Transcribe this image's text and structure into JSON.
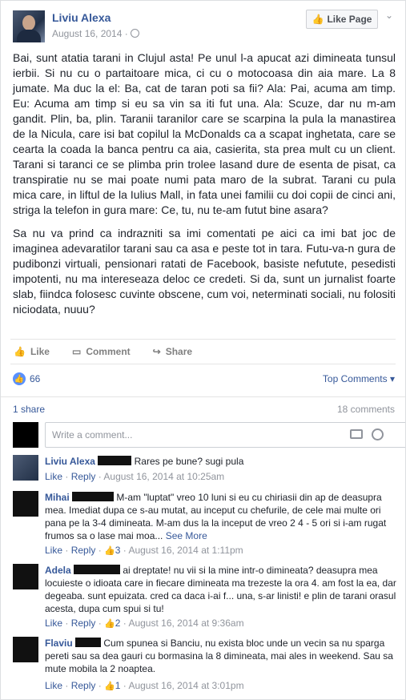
{
  "post": {
    "author": "Liviu Alexa",
    "date": "August 16, 2014 ·",
    "like_page": "Like Page",
    "paragraphs": [
      "Bai, sunt atatia tarani in Clujul asta! Pe unul l-a apucat azi dimineata tunsul ierbii. Si nu cu o partaitoare mica, ci cu o motocoasa din aia mare. La 8 jumate. Ma duc la el: Ba, cat de taran poti sa fii? Ala: Pai, acuma am timp. Eu: Acuma am timp si eu sa vin sa iti fut una. Ala: Scuze, dar nu m-am gandit. Plin, ba, plin. Taranii taranilor care se scarpina la pula la manastirea de la Nicula, care isi bat copilul la McDonalds ca a scapat inghetata, care se cearta la coada la banca pentru ca aia, casierita, sta prea mult cu un client. Tarani si taranci ce se plimba prin trolee lasand dure de esenta de pisat, ca transpiratie nu se mai poate numi pata maro de la subrat. Tarani cu pula mica care, in liftul de la Iulius Mall, in fata unei familii cu doi copii de cinci ani, striga la telefon in gura mare: Ce, tu, nu te-am futut bine asara?",
      "Sa nu va prind ca indrazniti sa imi comentati pe aici ca imi bat joc de imaginea adevaratilor tarani sau ca asa e peste tot in tara. Futu-va-n gura de pudibonzi virtuali, pensionari ratati de Facebook, basiste nefutute, pesedisti impotenti, nu ma intereseaza deloc ce credeti. Si da, sunt un jurnalist foarte slab, fiindca folosesc cuvinte obscene, cum voi, neterminati sociali, nu folositi niciodata, nuuu?"
    ],
    "actions": {
      "like": "Like",
      "comment": "Comment",
      "share": "Share"
    },
    "likes": "66",
    "sort": "Top Comments",
    "shares": "1 share",
    "comments_count": "18 comments",
    "write_placeholder": "Write a comment..."
  },
  "comments": [
    {
      "name": "Liviu Alexa",
      "text": "Rares pe bune? sugi pula",
      "like": "Like",
      "reply": "Reply",
      "likes": "",
      "date": "August 16, 2014 at 10:25am"
    },
    {
      "name": "Mihai",
      "text": "M-am \"luptat\" vreo 10 luni si eu cu chiriasii din ap de deasupra mea. Imediat dupa ce s-au mutat, au inceput cu chefurile, de cele mai multe ori pana pe la 3-4 dimineata. M-am dus la la inceput de vreo 2 4 - 5 ori si i-am rugat frumos sa o lase mai moa...",
      "more": "See More",
      "like": "Like",
      "reply": "Reply",
      "likes": "3",
      "date": "August 16, 2014 at 1:11pm"
    },
    {
      "name": "Adela",
      "text": "ai dreptate! nu vii si la mine intr-o dimineata? deasupra mea locuieste o idioata care in fiecare dimineata ma trezeste la ora 4. am fost la ea, dar degeaba. sunt epuizata. cred ca daca i-ai f... una, s-ar linisti! e plin de tarani orasul acesta, dupa cum spui si tu!",
      "like": "Like",
      "reply": "Reply",
      "likes": "2",
      "date": "August 16, 2014 at 9:36am"
    },
    {
      "name": "Flaviu",
      "text": "Cum spunea si Banciu, nu exista bloc unde un vecin sa nu sparga pereti sau sa dea gauri cu bormasina la 8 dimineata, mai ales in weekend. Sau sa mute mobila la 2 noaptea.",
      "like": "Like",
      "reply": "Reply",
      "likes": "1",
      "date": "August 16, 2014 at 3:01pm"
    }
  ]
}
